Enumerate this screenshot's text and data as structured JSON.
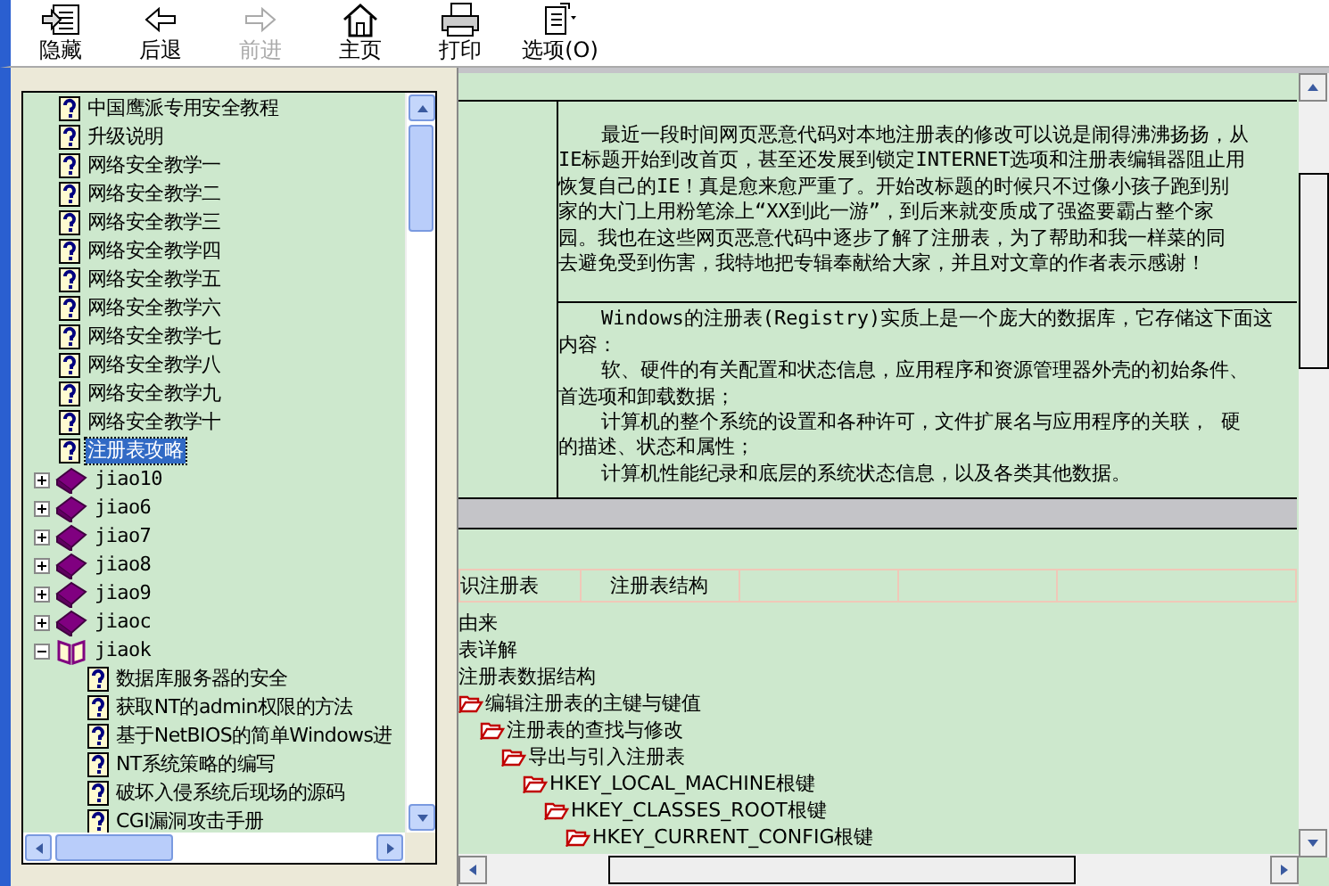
{
  "toolbar": [
    {
      "label": "隐藏",
      "kind": "hide",
      "disabled": false
    },
    {
      "label": "后退",
      "kind": "back",
      "disabled": false
    },
    {
      "label": "前进",
      "kind": "forward",
      "disabled": true
    },
    {
      "label": "主页",
      "kind": "home",
      "disabled": false
    },
    {
      "label": "打印",
      "kind": "print",
      "disabled": false
    },
    {
      "label": "选项(O)",
      "kind": "options",
      "disabled": false
    }
  ],
  "contents_tree": [
    {
      "kind": "topic",
      "label": "中国鹰派专用安全教程",
      "selected": false
    },
    {
      "kind": "topic",
      "label": "升级说明",
      "selected": false
    },
    {
      "kind": "topic",
      "label": "网络安全教学一",
      "selected": false
    },
    {
      "kind": "topic",
      "label": "网络安全教学二",
      "selected": false
    },
    {
      "kind": "topic",
      "label": "网络安全教学三",
      "selected": false
    },
    {
      "kind": "topic",
      "label": "网络安全教学四",
      "selected": false
    },
    {
      "kind": "topic",
      "label": "网络安全教学五",
      "selected": false
    },
    {
      "kind": "topic",
      "label": "网络安全教学六",
      "selected": false
    },
    {
      "kind": "topic",
      "label": "网络安全教学七",
      "selected": false
    },
    {
      "kind": "topic",
      "label": "网络安全教学八",
      "selected": false
    },
    {
      "kind": "topic",
      "label": "网络安全教学九",
      "selected": false
    },
    {
      "kind": "topic",
      "label": "网络安全教学十",
      "selected": false
    },
    {
      "kind": "topic",
      "label": "注册表攻略",
      "selected": true
    },
    {
      "kind": "book",
      "label": "jiao10",
      "expanded": false
    },
    {
      "kind": "book",
      "label": "jiao6",
      "expanded": false
    },
    {
      "kind": "book",
      "label": "jiao7",
      "expanded": false
    },
    {
      "kind": "book",
      "label": "jiao8",
      "expanded": false
    },
    {
      "kind": "book",
      "label": "jiao9",
      "expanded": false
    },
    {
      "kind": "book",
      "label": "jiaoc",
      "expanded": false
    },
    {
      "kind": "book",
      "label": "jiaok",
      "expanded": true,
      "children": [
        {
          "kind": "topic",
          "label": "数据库服务器的安全",
          "selected": false
        },
        {
          "kind": "topic",
          "label": "获取NT的admin权限的方法",
          "selected": false
        },
        {
          "kind": "topic",
          "label": "基于NetBIOS的简单Windows进",
          "selected": false
        },
        {
          "kind": "topic",
          "label": "NT系统策略的编写",
          "selected": false
        },
        {
          "kind": "topic",
          "label": "破坏入侵系统后现场的源码",
          "selected": false
        },
        {
          "kind": "topic",
          "label": "CGI漏洞攻击手册",
          "selected": false
        }
      ]
    }
  ],
  "article": {
    "intro": [
      {
        "text": "最近一段时间网页恶意代码对本地注册表的修改可以说是闹得沸沸扬扬，从",
        "indent": true
      },
      {
        "text": "IE标题开始到改首页，甚至还发展到锁定INTERNET选项和注册表编辑器阻止用",
        "indent": false
      },
      {
        "text": "恢复自己的IE！真是愈来愈严重了。开始改标题的时候只不过像小孩子跑到别",
        "indent": false
      },
      {
        "text": "家的大门上用粉笔涂上“XX到此一游”，到后来就变质成了强盗要霸占整个家",
        "indent": false
      },
      {
        "text": "园。我也在这些网页恶意代码中逐步了解了注册表，为了帮助和我一样菜的同",
        "indent": false
      },
      {
        "text": "去避免受到伤害，我特地把专辑奉献给大家，并且对文章的作者表示感谢！",
        "indent": false
      }
    ],
    "body": [
      {
        "text": "Windows的注册表(Registry)实质上是一个庞大的数据库，它存储这下面这",
        "indent": true
      },
      {
        "text": "内容：",
        "indent": false
      },
      {
        "text": "软、硬件的有关配置和状态信息，应用程序和资源管理器外壳的初始条件、",
        "indent": true
      },
      {
        "text": "首选项和卸载数据；",
        "indent": false
      },
      {
        "text": "计算机的整个系统的设置和各种许可，文件扩展名与应用程序的关联， 硬",
        "indent": true
      },
      {
        "text": "的描述、状态和属性；",
        "indent": false
      },
      {
        "text": "计算机性能纪录和底层的系统状态信息，以及各类其他数据。",
        "indent": true
      }
    ],
    "nav_links": [
      "识注册表",
      "注册表结构"
    ],
    "outline": [
      {
        "kind": "text",
        "label": "由来"
      },
      {
        "kind": "text",
        "label": "表详解"
      },
      {
        "kind": "text",
        "label": "注册表数据结构"
      },
      {
        "kind": "folder",
        "label": "编辑注册表的主键与键值",
        "children": [
          {
            "kind": "folder",
            "label": "注册表的查找与修改",
            "children": [
              {
                "kind": "folder",
                "label": "导出与引入注册表",
                "children": [
                  {
                    "kind": "folder",
                    "label": "HKEY_LOCAL_MACHINE根键",
                    "children": [
                      {
                        "kind": "folder",
                        "label": "HKEY_CLASSES_ROOT根键",
                        "children": [
                          {
                            "kind": "folder",
                            "label": "HKEY_CURRENT_CONFIG根键"
                          }
                        ]
                      }
                    ]
                  }
                ]
              }
            ]
          }
        ]
      }
    ]
  }
}
